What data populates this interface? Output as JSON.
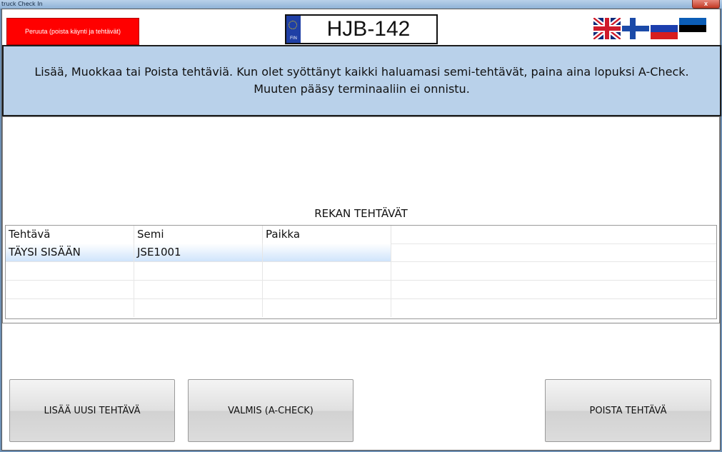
{
  "window": {
    "title": "truck Check In",
    "close_glyph": "x"
  },
  "header": {
    "cancel_label": "Peruuta (poista käynti ja tehtävät)",
    "plate": {
      "country_code": "FIN",
      "number": "HJB-142"
    },
    "flags": [
      {
        "name": "flag-uk-icon"
      },
      {
        "name": "flag-fi-icon"
      },
      {
        "name": "flag-ru-icon"
      },
      {
        "name": "flag-ee-icon"
      }
    ]
  },
  "info": {
    "line1": "Lisää, Muokkaa tai Poista tehtäviä. Kun olet syöttänyt kaikki haluamasi semi-tehtävät, paina aina lopuksi A-Check.",
    "line2": "Muuten pääsy terminaaliin ei onnistu."
  },
  "tasks": {
    "title": "REKAN TEHTÄVÄT",
    "columns": [
      "Tehtävä",
      "Semi",
      "Paikka",
      ""
    ],
    "rows": [
      [
        "TÄYSI SISÄÄN",
        "JSE1001",
        "",
        ""
      ]
    ]
  },
  "actions": {
    "add_label": "LISÄÄ UUSI TEHTÄVÄ",
    "done_label": "VALMIS (A-CHECK)",
    "delete_label": "POISTA TEHTÄVÄ"
  },
  "colors": {
    "cancel": "#ff0000",
    "banner": "#b9d1ea",
    "selected_row": "#cfe4fb"
  }
}
